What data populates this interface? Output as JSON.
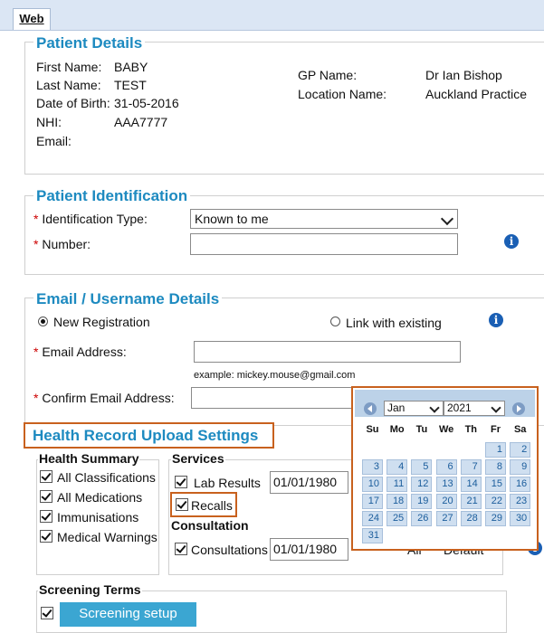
{
  "tabs": {
    "web": "Web"
  },
  "patient_details": {
    "title": "Patient Details",
    "first_name_label": "First Name:",
    "first_name": "BABY",
    "last_name_label": "Last Name:",
    "last_name": "TEST",
    "dob_label": "Date of Birth:",
    "dob": "31-05-2016",
    "nhi_label": "NHI:",
    "nhi": "AAA7777",
    "email_label": "Email:",
    "gp_name_label": "GP Name:",
    "gp_name": "Dr Ian Bishop",
    "location_label": "Location Name:",
    "location": "Auckland Practice"
  },
  "patient_identification": {
    "title": "Patient Identification",
    "id_type_label": "Identification Type:",
    "id_type_value": "Known to me",
    "number_label": "Number:"
  },
  "email_details": {
    "title": "Email / Username Details",
    "new_registration": "New Registration",
    "link_existing": "Link with existing",
    "email_label": "Email Address:",
    "example": "example: mickey.mouse@gmail.com",
    "confirm_label": "Confirm Email Address:"
  },
  "upload_settings": {
    "title": "Health Record Upload Settings",
    "health_summary": {
      "title": "Health Summary",
      "items": [
        "All Classifications",
        "All Medications",
        "Immunisations",
        "Medical Warnings"
      ]
    },
    "services": {
      "title": "Services",
      "lab_results": "Lab Results",
      "lab_date": "01/01/1980",
      "recalls": "Recalls"
    },
    "consultation": {
      "title": "Consultation",
      "consultations": "Consultations",
      "date": "01/01/1980",
      "all": "All",
      "default": "Default"
    },
    "screening": {
      "title": "Screening Terms",
      "button": "Screening setup"
    }
  },
  "calendar": {
    "month": "Jan",
    "year": "2021",
    "dow": [
      "Su",
      "Mo",
      "Tu",
      "We",
      "Th",
      "Fr",
      "Sa"
    ],
    "days": [
      "1",
      "2",
      "3",
      "4",
      "5",
      "6",
      "7",
      "8",
      "9",
      "10",
      "11",
      "12",
      "13",
      "14",
      "15",
      "16",
      "17",
      "18",
      "19",
      "20",
      "21",
      "22",
      "23",
      "24",
      "25",
      "26",
      "27",
      "28",
      "29",
      "30",
      "31"
    ]
  },
  "colors": {
    "accent": "#1d8ac0",
    "highlight": "#c8611e",
    "button": "#3ba6d2"
  }
}
